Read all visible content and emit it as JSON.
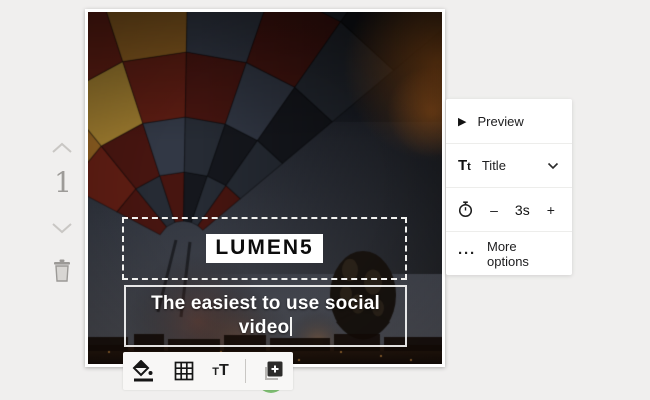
{
  "rail": {
    "slide_number": "1"
  },
  "canvas": {
    "logo_text": "LUMEN5",
    "headline_full": "The easiest to use social video",
    "headline_line1": "The easiest to use social",
    "headline_line2": "video"
  },
  "panel": {
    "preview_label": "Preview",
    "title_label": "Title",
    "duration_value": "3s",
    "decrease_label": "–",
    "increase_label": "+",
    "more_options_label": "More options"
  },
  "icons": {
    "play": "▶",
    "ellipsis": "···",
    "title_T": "T",
    "title_t": "t",
    "toolbar_t_small": "T",
    "toolbar_t_large": "T"
  },
  "toolbar_icon_names": [
    "fill-color",
    "layout-grid",
    "text-style",
    "add-media"
  ],
  "colors": {
    "page_bg": "#f0efee",
    "panel_bg": "#ffffff",
    "accent_green": "#7dbd72",
    "logo_chip_bg": "#ffffff",
    "logo_chip_text": "#0c0c0c"
  },
  "photo": {
    "sky": [
      "#0c0e13",
      "#1d212a",
      "#343841",
      "#46474d"
    ],
    "ground_top": "#2a1a10",
    "ground_bottom": "#140c07",
    "glow": "rgba(158,82,18,0.5)",
    "small_balloon": "#17120e",
    "window_light": "#8a5e2c"
  }
}
